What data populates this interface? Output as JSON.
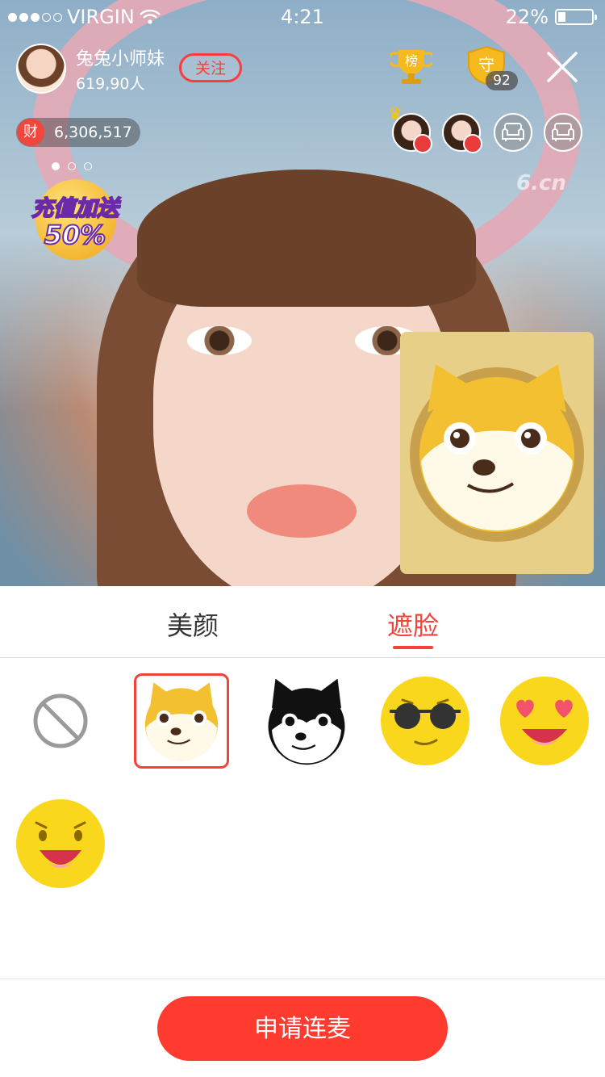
{
  "status_bar": {
    "carrier": "VIRGIN",
    "time": "4:21",
    "battery": "22%",
    "battery_level": 0.22
  },
  "host": {
    "name": "兔兔小师妹",
    "fans": "619,90人",
    "follow_label": "关注"
  },
  "ranking": {
    "rank_label": "榜",
    "guard_label": "守",
    "guard_count": "92"
  },
  "wealth": {
    "icon_label": "财",
    "value": "6,306,517"
  },
  "promo": {
    "line1": "充值加送",
    "line2": "50%"
  },
  "watermark": "6.cn",
  "tabs": [
    {
      "label": "美颜",
      "active": false
    },
    {
      "label": "遮脸",
      "active": true
    }
  ],
  "masks": [
    {
      "icon": "none-icon",
      "selected": false
    },
    {
      "icon": "shiba-dog-icon",
      "selected": true
    },
    {
      "icon": "husky-dog-icon",
      "selected": false
    },
    {
      "icon": "sunglasses-emoji-icon",
      "selected": false
    },
    {
      "icon": "heart-eyes-emoji-icon",
      "selected": false
    },
    {
      "icon": "grinning-emoji-icon",
      "selected": false
    }
  ],
  "apply_button": "申请连麦",
  "colors": {
    "accent": "#f2433b",
    "button": "#ff3b30",
    "emoji_yellow": "#f9d71c",
    "shiba_bg": "#e8cf87"
  }
}
